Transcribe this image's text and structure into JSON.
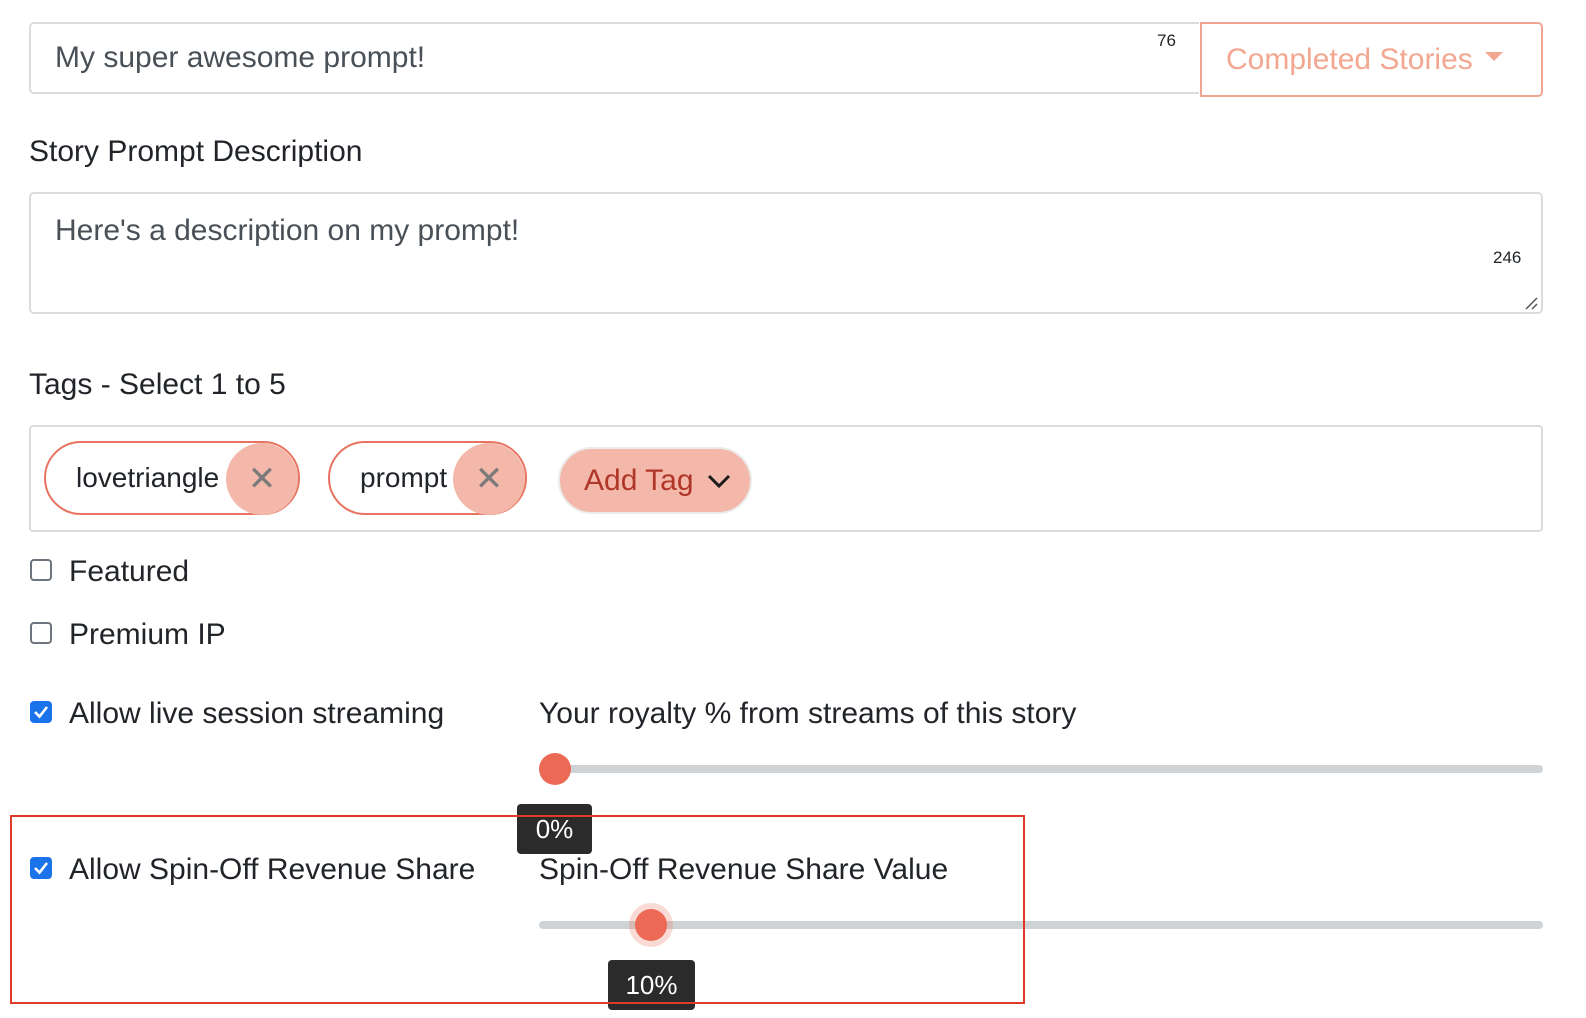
{
  "title_field": {
    "value": "My super awesome prompt!",
    "char_count": "76"
  },
  "category_dropdown": {
    "selected": "Completed Stories"
  },
  "description": {
    "label": "Story Prompt Description",
    "value": "Here's a description on my prompt!",
    "char_count": "246"
  },
  "tags": {
    "label": "Tags - Select 1 to 5",
    "items": [
      "lovetriangle",
      "prompt"
    ],
    "add_label": "Add Tag"
  },
  "options": {
    "featured": {
      "label": "Featured",
      "checked": false
    },
    "premium_ip": {
      "label": "Premium IP",
      "checked": false
    },
    "live_streaming": {
      "label": "Allow live session streaming",
      "checked": true
    },
    "spin_off": {
      "label": "Allow Spin-Off Revenue Share",
      "checked": true
    }
  },
  "royalty_slider": {
    "label": "Your royalty % from streams of this story",
    "value": 0,
    "display": "0%"
  },
  "spin_off_slider": {
    "label": "Spin-Off Revenue Share Value",
    "value": 10,
    "display": "10%"
  },
  "colors": {
    "accent": "#ec6a55",
    "checkbox": "#1a73e8",
    "highlight": "#e03a2b"
  }
}
